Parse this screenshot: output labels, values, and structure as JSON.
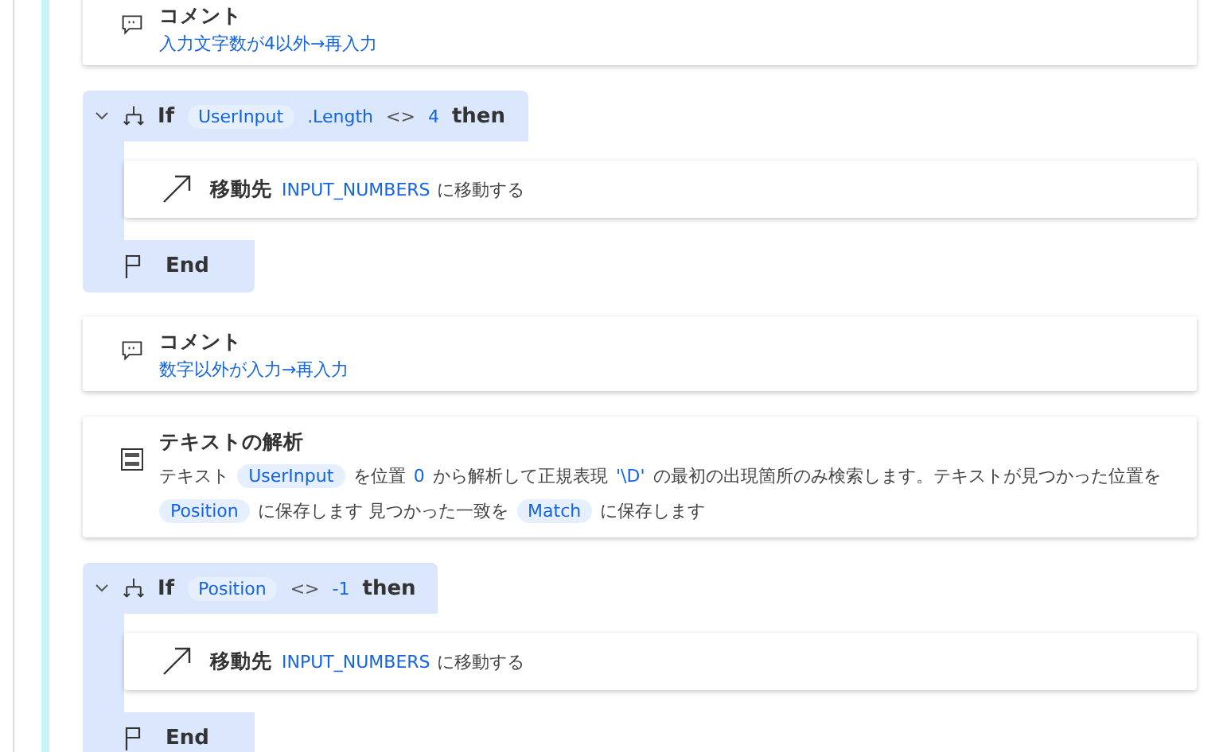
{
  "steps": [
    {
      "kind": "comment",
      "title": "コメント",
      "text": "入力文字数が4以外→再入力"
    },
    {
      "kind": "if",
      "expanded": true,
      "condition": [
        {
          "kind": "keyword",
          "text": "If"
        },
        {
          "kind": "chip",
          "text": "UserInput"
        },
        {
          "kind": "value",
          "text": ".Length"
        },
        {
          "kind": "operator",
          "text": "<>"
        },
        {
          "kind": "value",
          "text": "4"
        },
        {
          "kind": "keyword",
          "text": "then"
        }
      ],
      "children": [
        {
          "kind": "goto",
          "title": "移動先",
          "target": "INPUT_NUMBERS",
          "suffix": "に移動する"
        }
      ],
      "end": "End"
    },
    {
      "kind": "comment",
      "title": "コメント",
      "text": "数字以外が入力→再入力"
    },
    {
      "kind": "parse",
      "title": "テキストの解析",
      "description": [
        {
          "kind": "plain",
          "text": "テキスト"
        },
        {
          "kind": "chip",
          "text": "UserInput"
        },
        {
          "kind": "plain",
          "text": "を位置"
        },
        {
          "kind": "value",
          "text": "0"
        },
        {
          "kind": "plain",
          "text": "から解析して正規表現"
        },
        {
          "kind": "value",
          "text": "'\\D'"
        },
        {
          "kind": "plain",
          "text": "の最初の出現箇所のみ検索します。テキストが見つかった位置を"
        },
        {
          "kind": "chip",
          "text": "Position"
        },
        {
          "kind": "plain",
          "text": "に保存します 見つかった一致を"
        },
        {
          "kind": "chip",
          "text": "Match"
        },
        {
          "kind": "plain",
          "text": "に保存します"
        }
      ]
    },
    {
      "kind": "if",
      "expanded": true,
      "condition": [
        {
          "kind": "keyword",
          "text": "If"
        },
        {
          "kind": "chip",
          "text": "Position"
        },
        {
          "kind": "operator",
          "text": "<>"
        },
        {
          "kind": "value",
          "text": "-1"
        },
        {
          "kind": "keyword",
          "text": "then"
        }
      ],
      "children": [
        {
          "kind": "goto",
          "title": "移動先",
          "target": "INPUT_NUMBERS",
          "suffix": "に移動する"
        }
      ],
      "end": "End"
    }
  ]
}
